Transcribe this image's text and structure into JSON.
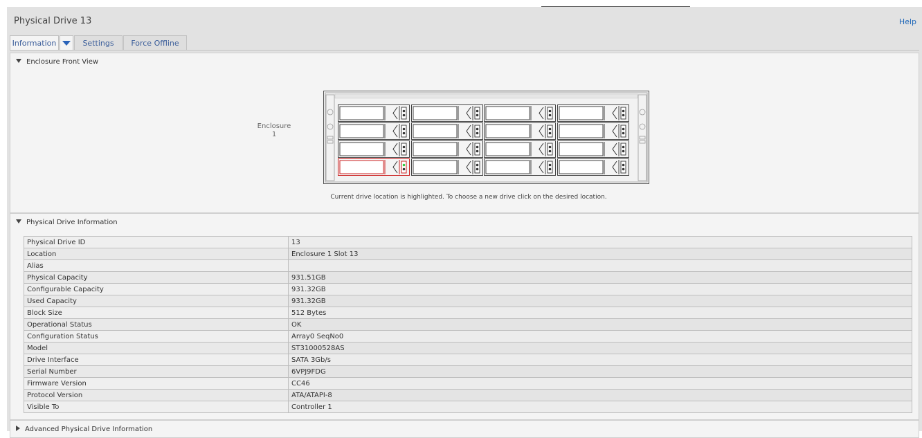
{
  "page": {
    "title": "Physical Drive 13",
    "help": "Help"
  },
  "tabs": {
    "information": "Information",
    "settings": "Settings",
    "force_offline": "Force Offline"
  },
  "enclosure_view": {
    "header": "Enclosure Front View",
    "enclosure_label": "Enclosure",
    "enclosure_number": "1",
    "selected_slot": 13,
    "note": "Current drive location is highlighted. To choose a new drive click on the desired location."
  },
  "drive_info": {
    "header": "Physical Drive Information",
    "rows": [
      {
        "label": "Physical Drive ID",
        "value": "13"
      },
      {
        "label": "Location",
        "value": "Enclosure 1 Slot 13"
      },
      {
        "label": "Alias",
        "value": ""
      },
      {
        "label": "Physical Capacity",
        "value": "931.51GB"
      },
      {
        "label": "Configurable Capacity",
        "value": "931.32GB"
      },
      {
        "label": "Used Capacity",
        "value": "931.32GB"
      },
      {
        "label": "Block Size",
        "value": "512 Bytes"
      },
      {
        "label": "Operational Status",
        "value": "OK"
      },
      {
        "label": "Configuration Status",
        "value": "Array0 SeqNo0"
      },
      {
        "label": "Model",
        "value": "ST31000528AS"
      },
      {
        "label": "Drive Interface",
        "value": "SATA 3Gb/s"
      },
      {
        "label": "Serial Number",
        "value": "6VPJ9FDG"
      },
      {
        "label": "Firmware Version",
        "value": "CC46"
      },
      {
        "label": "Protocol Version",
        "value": "ATA/ATAPI-8"
      },
      {
        "label": "Visible To",
        "value": "Controller 1"
      }
    ]
  },
  "advanced": {
    "header": "Advanced Physical Drive Information"
  },
  "colors": {
    "link": "#1e67b8",
    "selected_slot_border": "#cc2222",
    "activity_led": "#2ecc40"
  }
}
